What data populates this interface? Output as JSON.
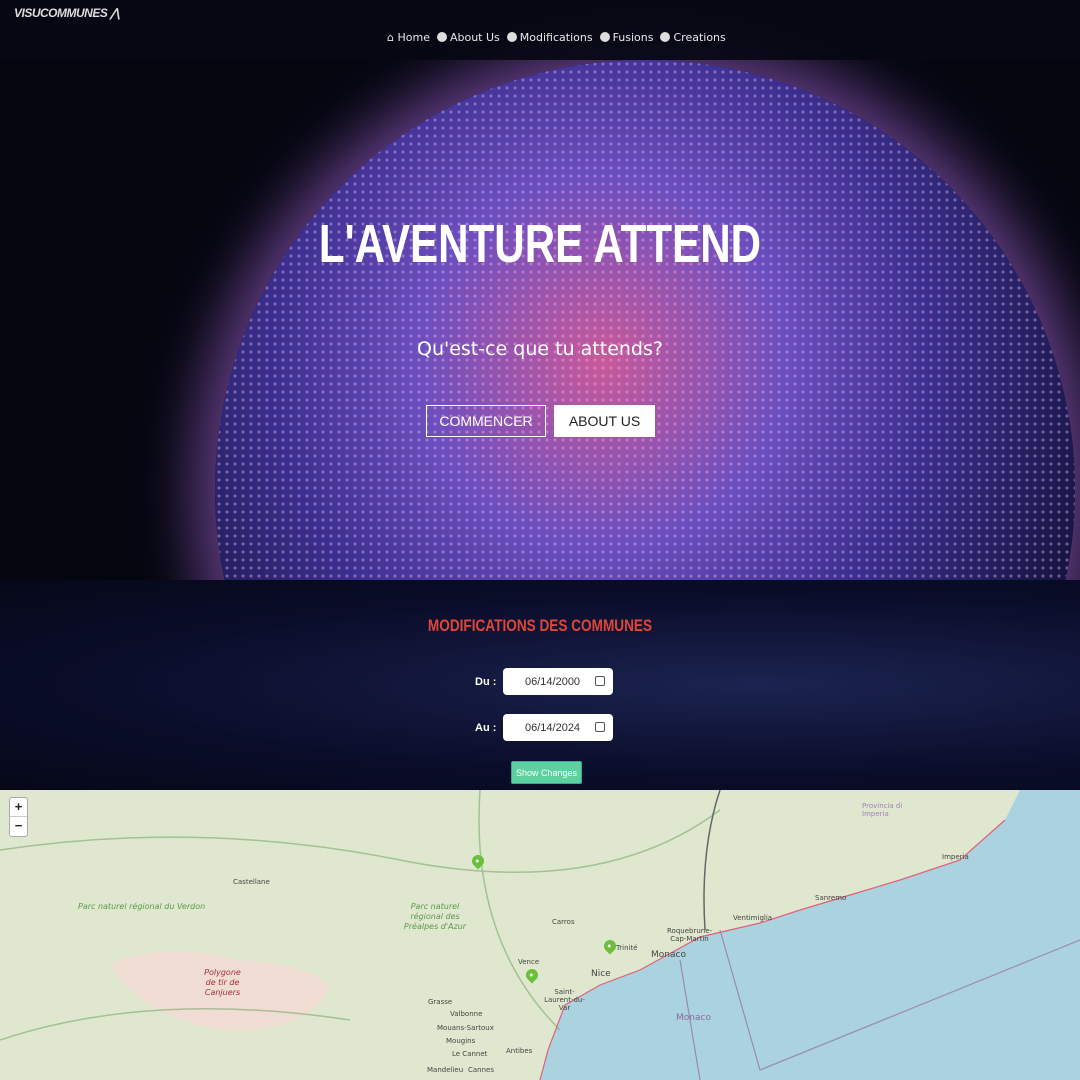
{
  "brand": {
    "logo": "VISUCOMMUNES"
  },
  "nav": [
    {
      "label": "Home",
      "icon": "home-icon"
    },
    {
      "label": "About Us",
      "icon": "smiley-icon"
    },
    {
      "label": "Modifications",
      "icon": "smiley-icon"
    },
    {
      "label": "Fusions",
      "icon": "smiley-icon"
    },
    {
      "label": "Creations",
      "icon": "smiley-icon"
    }
  ],
  "hero": {
    "title": "L'AVENTURE ATTEND",
    "subtitle": "Qu'est-ce que tu attends?",
    "primary_button": "COMMENCER",
    "secondary_button": "ABOUT US"
  },
  "modifications": {
    "title": "MODIFICATIONS DES COMMUNES",
    "from_label": "Du :",
    "from_value": "06/14/2000",
    "to_label": "Au :",
    "to_value": "06/14/2024",
    "submit": "Show Changes",
    "accent": "#e0453a",
    "button_color": "#5dd0a0"
  },
  "map": {
    "zoom_in": "+",
    "zoom_out": "−",
    "marker_color": "#6bbf3a",
    "labels": {
      "castellane": "Castellane",
      "verdon": "Parc naturel régional du Verdon",
      "canjuers": "Polygone de tir de Canjuers",
      "prealpes": "Parc naturel régional des Préalpes d'Azur",
      "vence": "Vence",
      "grasse": "Grasse",
      "valbonne": "Valbonne",
      "mouans": "Mouans-Sartoux",
      "mougins": "Mougins",
      "cannet": "Le Cannet",
      "antibes": "Antibes",
      "mandelieu": "Mandelieu",
      "cannes": "Cannes",
      "carros": "Carros",
      "trinite": "Trinité",
      "nice": "Nice",
      "stlaurent": "Saint-Laurent-du-Var",
      "monaco": "Monaco",
      "roquebrune": "Roquebrune-Cap-Martin",
      "ventimiglia": "Ventimiglia",
      "sanremo": "Sanremo",
      "imperia": "Imperia",
      "provincia": "Provincia di Imperia",
      "monaco_sea": "Monaco"
    }
  }
}
